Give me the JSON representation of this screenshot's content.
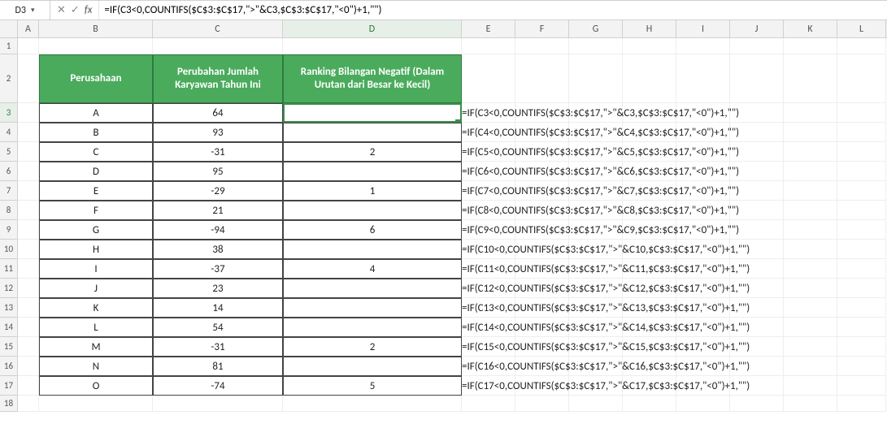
{
  "namebox": "D3",
  "formula_bar": "=IF(C3<0,COUNTIFS($C$3:$C$17,\">\"&C3,$C$3:$C$17,\"<0\")+1,\"\")",
  "icons": {
    "cancel": "✕",
    "accept": "✓",
    "fx": "fx",
    "dropdown": "▾"
  },
  "columns": [
    "A",
    "B",
    "C",
    "D",
    "E",
    "F",
    "G",
    "H",
    "I",
    "J",
    "K",
    "L"
  ],
  "row_labels": [
    "1",
    "2",
    "3",
    "4",
    "5",
    "6",
    "7",
    "8",
    "9",
    "10",
    "11",
    "12",
    "13",
    "14",
    "15",
    "16",
    "17",
    "18"
  ],
  "selected": {
    "col": "D",
    "row": "3"
  },
  "table": {
    "headers": {
      "B": "Perusahaan",
      "C": "Perubahan Jumlah Karyawan Tahun Ini",
      "D": "Ranking Bilangan Negatif (Dalam Urutan dari Besar ke Kecil)"
    },
    "rows": [
      {
        "B": "A",
        "C": "64",
        "D": ""
      },
      {
        "B": "B",
        "C": "93",
        "D": ""
      },
      {
        "B": "C",
        "C": "-31",
        "D": "2"
      },
      {
        "B": "D",
        "C": "95",
        "D": ""
      },
      {
        "B": "E",
        "C": "-29",
        "D": "1"
      },
      {
        "B": "F",
        "C": "21",
        "D": ""
      },
      {
        "B": "G",
        "C": "-94",
        "D": "6"
      },
      {
        "B": "H",
        "C": "38",
        "D": ""
      },
      {
        "B": "I",
        "C": "-37",
        "D": "4"
      },
      {
        "B": "J",
        "C": "23",
        "D": ""
      },
      {
        "B": "K",
        "C": "14",
        "D": ""
      },
      {
        "B": "L",
        "C": "54",
        "D": ""
      },
      {
        "B": "M",
        "C": "-31",
        "D": "2"
      },
      {
        "B": "N",
        "C": "81",
        "D": ""
      },
      {
        "B": "O",
        "C": "-74",
        "D": "5"
      }
    ]
  },
  "formulas_E": [
    "=IF(C3<0,COUNTIFS($C$3:$C$17,\">\"&C3,$C$3:$C$17,\"<0\")+1,\"\")",
    "=IF(C4<0,COUNTIFS($C$3:$C$17,\">\"&C4,$C$3:$C$17,\"<0\")+1,\"\")",
    "=IF(C5<0,COUNTIFS($C$3:$C$17,\">\"&C5,$C$3:$C$17,\"<0\")+1,\"\")",
    "=IF(C6<0,COUNTIFS($C$3:$C$17,\">\"&C6,$C$3:$C$17,\"<0\")+1,\"\")",
    "=IF(C7<0,COUNTIFS($C$3:$C$17,\">\"&C7,$C$3:$C$17,\"<0\")+1,\"\")",
    "=IF(C8<0,COUNTIFS($C$3:$C$17,\">\"&C8,$C$3:$C$17,\"<0\")+1,\"\")",
    "=IF(C9<0,COUNTIFS($C$3:$C$17,\">\"&C9,$C$3:$C$17,\"<0\")+1,\"\")",
    "=IF(C10<0,COUNTIFS($C$3:$C$17,\">\"&C10,$C$3:$C$17,\"<0\")+1,\"\")",
    "=IF(C11<0,COUNTIFS($C$3:$C$17,\">\"&C11,$C$3:$C$17,\"<0\")+1,\"\")",
    "=IF(C12<0,COUNTIFS($C$3:$C$17,\">\"&C12,$C$3:$C$17,\"<0\")+1,\"\")",
    "=IF(C13<0,COUNTIFS($C$3:$C$17,\">\"&C13,$C$3:$C$17,\"<0\")+1,\"\")",
    "=IF(C14<0,COUNTIFS($C$3:$C$17,\">\"&C14,$C$3:$C$17,\"<0\")+1,\"\")",
    "=IF(C15<0,COUNTIFS($C$3:$C$17,\">\"&C15,$C$3:$C$17,\"<0\")+1,\"\")",
    "=IF(C16<0,COUNTIFS($C$3:$C$17,\">\"&C16,$C$3:$C$17,\"<0\")+1,\"\")",
    "=IF(C17<0,COUNTIFS($C$3:$C$17,\">\"&C17,$C$3:$C$17,\"<0\")+1,\"\")"
  ]
}
